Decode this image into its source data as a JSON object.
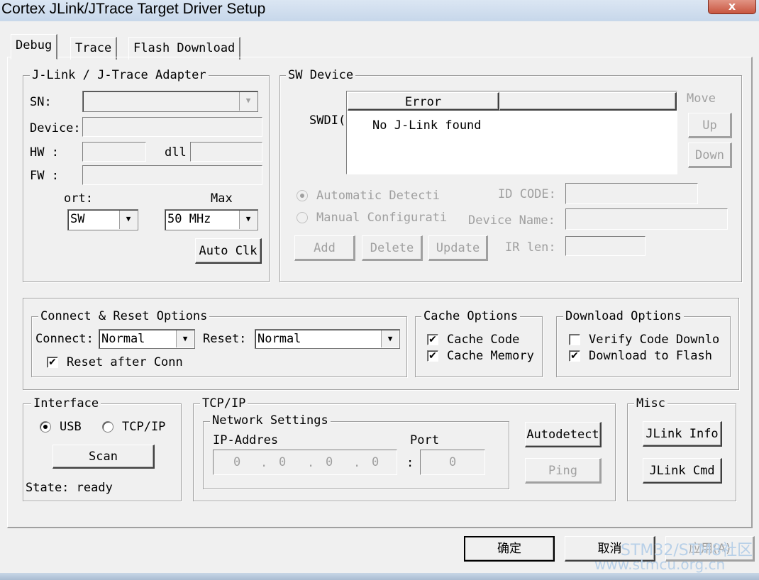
{
  "window": {
    "title": "Cortex JLink/JTrace Target Driver Setup",
    "close_label": "x"
  },
  "tabs": [
    {
      "label": "Debug"
    },
    {
      "label": "Trace"
    },
    {
      "label": "Flash Download"
    }
  ],
  "adapter": {
    "group_label": "J-Link / J-Trace Adapter",
    "sn_label": "SN:",
    "device_label": "Device:",
    "hw_label": "HW :",
    "dll_label": "dll",
    "fw_label": "FW :",
    "port_label": "ort:",
    "max_label": "Max",
    "port_value": "SW",
    "max_value": "50 MHz",
    "auto_clk_label": "Auto Clk"
  },
  "sw_device": {
    "group_label": "SW Device",
    "swdio_label": "SWDI(",
    "col_error": "Error",
    "message": "No J-Link found",
    "move_label": "Move",
    "up_label": "Up",
    "down_label": "Down",
    "auto_detect_label": "Automatic Detecti",
    "manual_config_label": "Manual Configurati",
    "id_code_label": "ID CODE:",
    "device_name_label": "Device Name:",
    "ir_len_label": "IR len:",
    "add_label": "Add",
    "delete_label": "Delete",
    "update_label": "Update"
  },
  "connect_reset": {
    "group_label": "Connect & Reset Options",
    "connect_label": "Connect:",
    "connect_value": "Normal",
    "reset_label": "Reset:",
    "reset_value": "Normal",
    "reset_after_label": "Reset after Conn"
  },
  "cache": {
    "group_label": "Cache Options",
    "code_label": "Cache Code",
    "memory_label": "Cache Memory"
  },
  "download": {
    "group_label": "Download Options",
    "verify_label": "Verify Code Downlo",
    "flash_label": "Download to Flash"
  },
  "interface": {
    "group_label": "Interface",
    "usb_label": "USB",
    "tcpip_label": "TCP/IP",
    "scan_label": "Scan",
    "state_text": "State: ready"
  },
  "tcpip": {
    "group_label": "TCP/IP",
    "network_label": "Network Settings",
    "ip_label": "IP-Addres",
    "port_label": "Port",
    "ip_octets": [
      "0",
      "0",
      "0",
      "0"
    ],
    "port_value": "0",
    "colon": ":",
    "autodetect_label": "Autodetect",
    "ping_label": "Ping"
  },
  "misc": {
    "group_label": "Misc",
    "jlink_info_label": "JLink Info",
    "jlink_cmd_label": "JLink Cmd"
  },
  "footer": {
    "ok_label": "确定",
    "cancel_label": "取消",
    "apply_label": "应用(A)"
  },
  "watermark": {
    "line1": "STM32/STM8社区",
    "line2": "www.stmcu.org.cn"
  }
}
